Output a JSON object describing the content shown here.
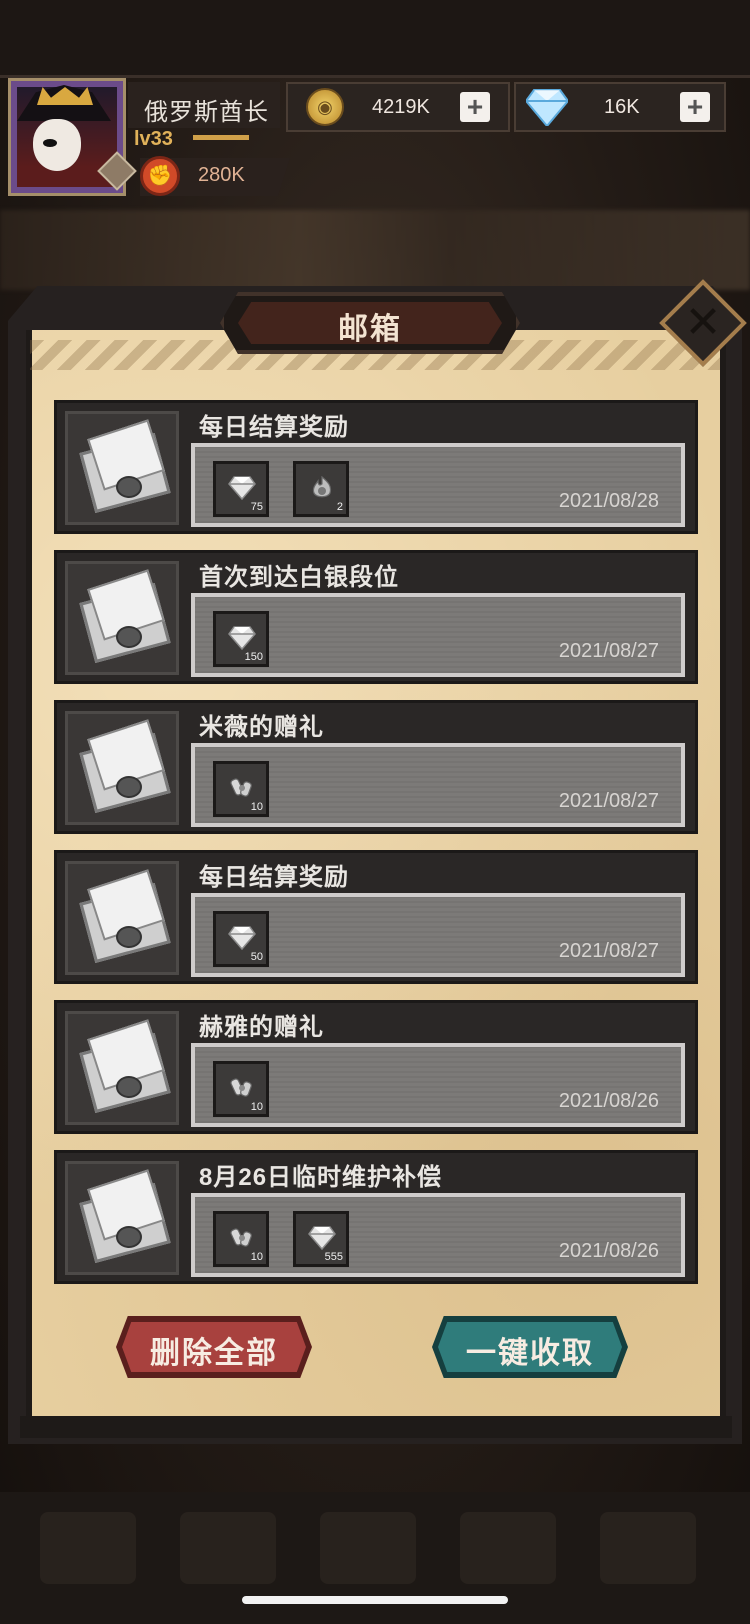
{
  "player": {
    "name": "俄罗斯酋长",
    "level": "lv33",
    "level_progress": 0.9,
    "power": "280K"
  },
  "currency": {
    "gold": "4219K",
    "gems": "16K"
  },
  "mailbox": {
    "title": "邮箱",
    "mails": [
      {
        "title": "每日结算奖励",
        "date": "2021/08/28",
        "items": [
          {
            "icon": "diamond-icon",
            "count": "75"
          },
          {
            "icon": "flame-token-icon",
            "count": "2"
          }
        ]
      },
      {
        "title": "首次到达白银段位",
        "date": "2021/08/27",
        "items": [
          {
            "icon": "diamond-icon",
            "count": "150"
          }
        ]
      },
      {
        "title": "米薇的赠礼",
        "date": "2021/08/27",
        "items": [
          {
            "icon": "scroll-bundle-icon",
            "count": "10"
          }
        ]
      },
      {
        "title": "每日结算奖励",
        "date": "2021/08/27",
        "items": [
          {
            "icon": "diamond-icon",
            "count": "50"
          }
        ]
      },
      {
        "title": "赫雅的赠礼",
        "date": "2021/08/26",
        "items": [
          {
            "icon": "scroll-bundle-icon",
            "count": "10"
          }
        ]
      },
      {
        "title": "8月26日临时维护补偿",
        "date": "2021/08/26",
        "items": [
          {
            "icon": "scroll-bundle-icon",
            "count": "10"
          },
          {
            "icon": "diamond-icon",
            "count": "555"
          }
        ]
      }
    ],
    "delete_all_label": "删除全部",
    "collect_all_label": "一键收取"
  },
  "colors": {
    "delete_button": "#a8413e",
    "collect_button": "#2f7c7b",
    "parchment": "#e7cfa0"
  }
}
